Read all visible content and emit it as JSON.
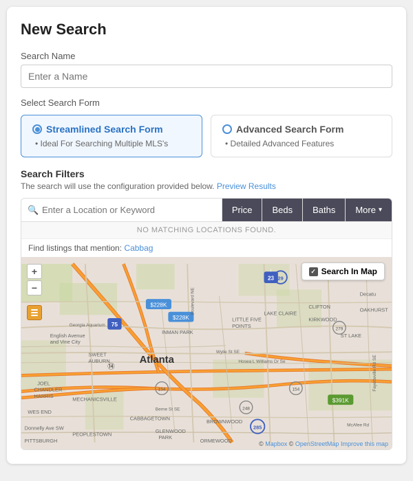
{
  "page": {
    "title": "New Search"
  },
  "search_name": {
    "label": "Search Name",
    "placeholder": "Enter a Name"
  },
  "select_form": {
    "label": "Select Search Form",
    "options": [
      {
        "id": "streamlined",
        "label": "Streamlined Search Form",
        "description": "Ideal For Searching Multiple MLS's",
        "selected": true
      },
      {
        "id": "advanced",
        "label": "Advanced Search Form",
        "description": "Detailed Advanced Features",
        "selected": false
      }
    ]
  },
  "search_filters": {
    "title": "Search Filters",
    "description": "The search will use the configuration provided below.",
    "preview_link": "Preview Results",
    "location_placeholder": "Enter a Location or Keyword",
    "no_match_text": "NO MATCHING LOCATIONS FOUND.",
    "find_listings_prefix": "Find listings that mention: ",
    "find_listings_link": "Cabbag"
  },
  "filter_buttons": [
    {
      "id": "price",
      "label": "Price"
    },
    {
      "id": "beds",
      "label": "Beds"
    },
    {
      "id": "baths",
      "label": "Baths"
    },
    {
      "id": "more",
      "label": "More",
      "has_arrow": true
    }
  ],
  "map": {
    "search_in_map_label": "Search In Map",
    "attribution": "© Mapbox © OpenStreetMap Improve this map",
    "zoom_in": "+",
    "zoom_out": "−",
    "city_label": "Atlanta"
  }
}
